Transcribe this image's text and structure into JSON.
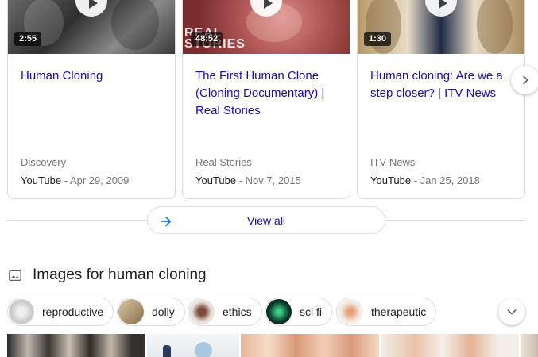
{
  "videos": [
    {
      "duration": "2:55",
      "title": "Human Cloning",
      "channel": "Discovery",
      "source": "YouTube",
      "date": "Apr 29, 2009",
      "overlay": ""
    },
    {
      "duration": "48:52",
      "title": "The First Human Clone (Cloning Documentary) | Real Stories",
      "channel": "Real Stories",
      "source": "YouTube",
      "date": "Nov 7, 2015",
      "overlay": "REAL STORIES"
    },
    {
      "duration": "1:30",
      "title": "Human cloning: Are we a step closer? | ITV News",
      "channel": "ITV News",
      "source": "YouTube",
      "date": "Jan 25, 2018",
      "overlay": ""
    }
  ],
  "meta_separator": " - ",
  "view_all_label": "View all",
  "images_section": {
    "title": "Images for human cloning",
    "chips": [
      {
        "label": "reproductive"
      },
      {
        "label": "dolly"
      },
      {
        "label": "ethics"
      },
      {
        "label": "sci fi"
      },
      {
        "label": "therapeutic"
      }
    ]
  },
  "colors": {
    "link": "#1a0dab",
    "meta": "#70757a",
    "border": "#dadce0",
    "view_all_arrow": "#1a73e8"
  },
  "icons": {
    "next": "chevron-right-icon",
    "view_all": "arrow-right-icon",
    "images": "image-icon",
    "chips_more": "chevron-down-icon",
    "play": "play-icon"
  }
}
